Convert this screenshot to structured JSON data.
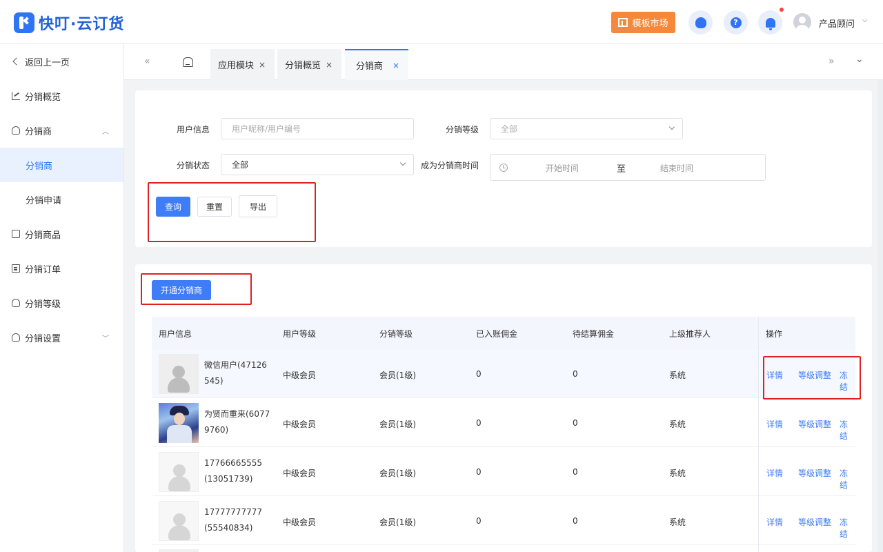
{
  "app": {
    "brand": "快叮·云订货",
    "market_button": "模板市场",
    "help_glyph": "?",
    "user_name": "产品顾问"
  },
  "sidebar": {
    "back": "返回上一页",
    "items": [
      {
        "label": "分销概览",
        "icon": "chart-icon"
      },
      {
        "label": "分销商",
        "icon": "users-icon",
        "expanded": true
      },
      {
        "label": "分销商",
        "icon": "",
        "active": true
      },
      {
        "label": "分销申请",
        "icon": ""
      },
      {
        "label": "分销商品",
        "icon": "box-icon"
      },
      {
        "label": "分销订单",
        "icon": "order-icon"
      },
      {
        "label": "分销等级",
        "icon": "level-icon"
      },
      {
        "label": "分销设置",
        "icon": "settings-icon"
      }
    ]
  },
  "tabs": {
    "items": [
      {
        "label": "应用模块"
      },
      {
        "label": "分销概览"
      },
      {
        "label": "分销商",
        "active": true
      }
    ],
    "close_glyph": "×",
    "prev_glyph": "«",
    "next_glyph": "»",
    "more_glyph": "⌄"
  },
  "filters": {
    "user_info_label": "用户信息",
    "user_info_placeholder": "用户昵称/用户编号",
    "level_label": "分销等级",
    "level_value": "全部",
    "status_label": "分销状态",
    "status_value": "全部",
    "time_label": "成为分销商时间",
    "time_start": "开始时间",
    "time_sep": "至",
    "time_end": "结束时间",
    "query_button": "查询",
    "reset_button": "重置",
    "export_button": "导出"
  },
  "actions": {
    "open_distributor_button": "开通分销商"
  },
  "table": {
    "columns": [
      "用户信息",
      "用户等级",
      "分销等级",
      "已入账佣金",
      "待结算佣金",
      "上级推荐人",
      "操作"
    ],
    "op_labels": {
      "detail": "详情",
      "adjust": "等级调整",
      "freeze": "冻结"
    },
    "rows": [
      {
        "user": "微信用户(47126545)",
        "avatar": "placeholder",
        "user_level": "中级会员",
        "dist_level": "会员(1级)",
        "settled": "0",
        "pending": "0",
        "referrer": "系统"
      },
      {
        "user": "为贤而重来(60779760)",
        "avatar": "photo",
        "user_level": "中级会员",
        "dist_level": "会员(1级)",
        "settled": "0",
        "pending": "0",
        "referrer": "系统"
      },
      {
        "user": "17766665555(13051739)",
        "avatar": "placeholder",
        "user_level": "中级会员",
        "dist_level": "会员(1级)",
        "settled": "0",
        "pending": "0",
        "referrer": "系统"
      },
      {
        "user": "17777777777(55540834)",
        "avatar": "placeholder",
        "user_level": "中级会员",
        "dist_level": "会员(1级)",
        "settled": "0",
        "pending": "0",
        "referrer": "系统"
      }
    ]
  },
  "colors": {
    "accent": "#2f74f5",
    "button_primary": "#3f7cf7",
    "market": "#f5883b",
    "highlight_box": "#e02020"
  }
}
